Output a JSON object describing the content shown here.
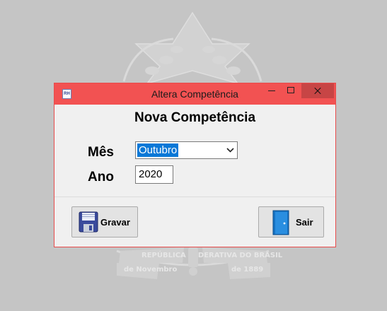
{
  "watermark": {
    "icon": "brasao-coat-of-arms",
    "motto": "REPÚBLICA FEDERATIVA DO BRASIL",
    "date_left": "de Novembro",
    "date_right": "de 1889"
  },
  "window": {
    "title": "Altera Competência",
    "icon": "app-logo-icon",
    "controls": {
      "minimize": "minimize-icon",
      "maximize": "maximize-icon",
      "close": "close-icon"
    },
    "titlebar_color": "#f25252"
  },
  "form": {
    "heading": "Nova Competência",
    "mes_label": "Mês",
    "mes_value": "Outubro",
    "ano_label": "Ano",
    "ano_value": "2020"
  },
  "buttons": {
    "gravar": {
      "label": "Gravar",
      "icon": "floppy-disk-icon"
    },
    "sair": {
      "label": "Sair",
      "icon": "door-exit-icon"
    }
  }
}
